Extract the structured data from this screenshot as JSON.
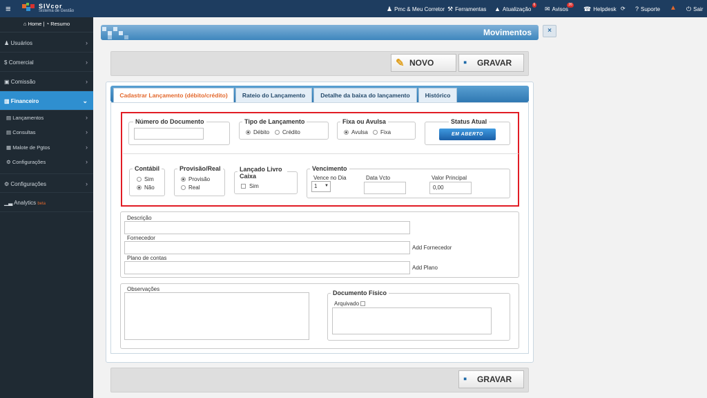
{
  "topbar": {
    "brand": "SIVcor",
    "brand_sub": "Sistema de Gestão",
    "items": [
      {
        "icon": "user-icon",
        "label": "Pmc & Meu Corretor"
      },
      {
        "icon": "tools-icon",
        "label": "Ferramentas"
      },
      {
        "icon": "warning-icon",
        "label": "Atualização",
        "badge": "6"
      },
      {
        "icon": "chat-icon",
        "label": "Avisos",
        "badge": "26"
      },
      {
        "icon": "helpdesk-icon",
        "label": "Helpdesk"
      },
      {
        "icon": "refresh-icon",
        "label": ""
      },
      {
        "icon": "help-icon",
        "label": "Suporte"
      },
      {
        "icon": "alert-icon",
        "label": ""
      },
      {
        "icon": "power-icon",
        "label": "Sair"
      }
    ]
  },
  "sidebar": {
    "home": "Home",
    "resumo": "Resumo",
    "items": [
      {
        "icon": "users-icon",
        "label": "Usuários"
      },
      {
        "icon": "dollar-icon",
        "label": "Comercial"
      },
      {
        "icon": "money-icon",
        "label": "Comissão"
      },
      {
        "icon": "bank-icon",
        "label": "Financeiro",
        "active": true
      }
    ],
    "sub": [
      {
        "label": "Lançamentos"
      },
      {
        "label": "Consultas"
      },
      {
        "label": "Malote de Pgtos"
      },
      {
        "label": "Configurações"
      }
    ],
    "bottom": [
      {
        "icon": "gears-icon",
        "label": "Configurações"
      },
      {
        "icon": "chart-icon",
        "label": "Analytics",
        "badge": "beta"
      }
    ]
  },
  "header": {
    "title": "Movimentos",
    "close": "×"
  },
  "toolbar": {
    "new_label": "NOVO",
    "save_label": "GRAVAR"
  },
  "tabs": [
    {
      "label": "Cadastrar Lançamento (débito/crédito)"
    },
    {
      "label": "Rateio do Lançamento"
    },
    {
      "label": "Detalhe da baixa do lançamento"
    },
    {
      "label": "Histórico"
    }
  ],
  "form": {
    "numero_documento": {
      "legend": "Número do Documento",
      "value": ""
    },
    "tipo_lancamento": {
      "legend": "Tipo de Lançamento",
      "options": [
        "Débito",
        "Crédito"
      ],
      "selected": "Débito"
    },
    "fixa_avulsa": {
      "legend": "Fixa ou Avulsa",
      "options": [
        "Avulsa",
        "Fixa"
      ],
      "selected": "Avulsa"
    },
    "status": {
      "legend": "Status Atual",
      "value": "EM ABERTO"
    },
    "contabil": {
      "legend": "Contábil",
      "options": [
        "Sim",
        "Não"
      ],
      "selected": "Não"
    },
    "provisao_real": {
      "legend": "Provisão/Real",
      "options": [
        "Provisão",
        "Real"
      ],
      "selected": "Provisão"
    },
    "lancado_livro": {
      "legend": "Lançado Livro Caixa",
      "checkbox": "Sim",
      "checked": false
    },
    "vencimento": {
      "legend": "Vencimento",
      "vence_label": "Vence no Dia",
      "vence_value": "1",
      "data_label": "Data Vcto",
      "data_value": "",
      "valor_label": "Valor Principal",
      "valor_value": "0,00"
    },
    "descricao": {
      "label": "Descrição",
      "value": ""
    },
    "fornecedor": {
      "label": "Fornecedor",
      "add": "Add Fornecedor",
      "value": ""
    },
    "plano": {
      "label": "Plano de contas",
      "add": "Add Plano",
      "value": ""
    },
    "observacoes": {
      "label": "Observações",
      "value": ""
    },
    "documento_fisico": {
      "legend": "Documento Físico",
      "checkbox": "Arquivado",
      "checked": false
    }
  },
  "colors": {
    "topbar": "#1e3d60",
    "sidebar": "#1f2a33",
    "active": "#2f8fd0",
    "accent": "#e3682c",
    "highlight": "#e11c24"
  }
}
